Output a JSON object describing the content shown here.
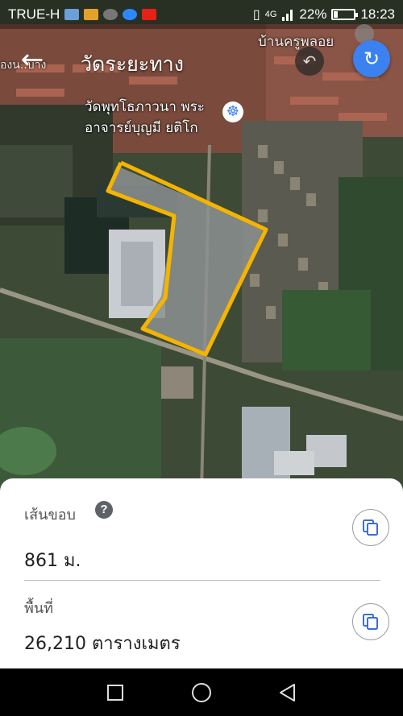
{
  "status_bar": {
    "carrier": "TRUE-H",
    "signal_label": "4G",
    "battery_percent_text": "22%",
    "battery_level": 0.22,
    "time": "18:23"
  },
  "map": {
    "title": "วัดระยะทาง",
    "labels": {
      "left_partial": "องน..บาง",
      "north_place": "บ้านครูพลอย",
      "temple_line1": "วัดพุทโธภาวนา พระ",
      "temple_line2": "อาจารย์บุญมี ยติโก"
    },
    "measure_outline_color": "#f5b400",
    "back_icon": "arrow-left-icon",
    "undo_icon": "undo-icon",
    "refresh_icon": "refresh-icon",
    "temple_icon": "dharma-wheel-icon"
  },
  "measurement": {
    "perimeter_label": "เส้นขอบ",
    "perimeter_value": "861 ม.",
    "area_label": "พื้นที่",
    "area_value": "26,210 ตารางเมตร",
    "help_icon": "help-icon",
    "copy_icon": "copy-icon"
  },
  "nav": {
    "recents_icon": "square-icon",
    "home_icon": "circle-icon",
    "back_icon": "triangle-back-icon"
  }
}
